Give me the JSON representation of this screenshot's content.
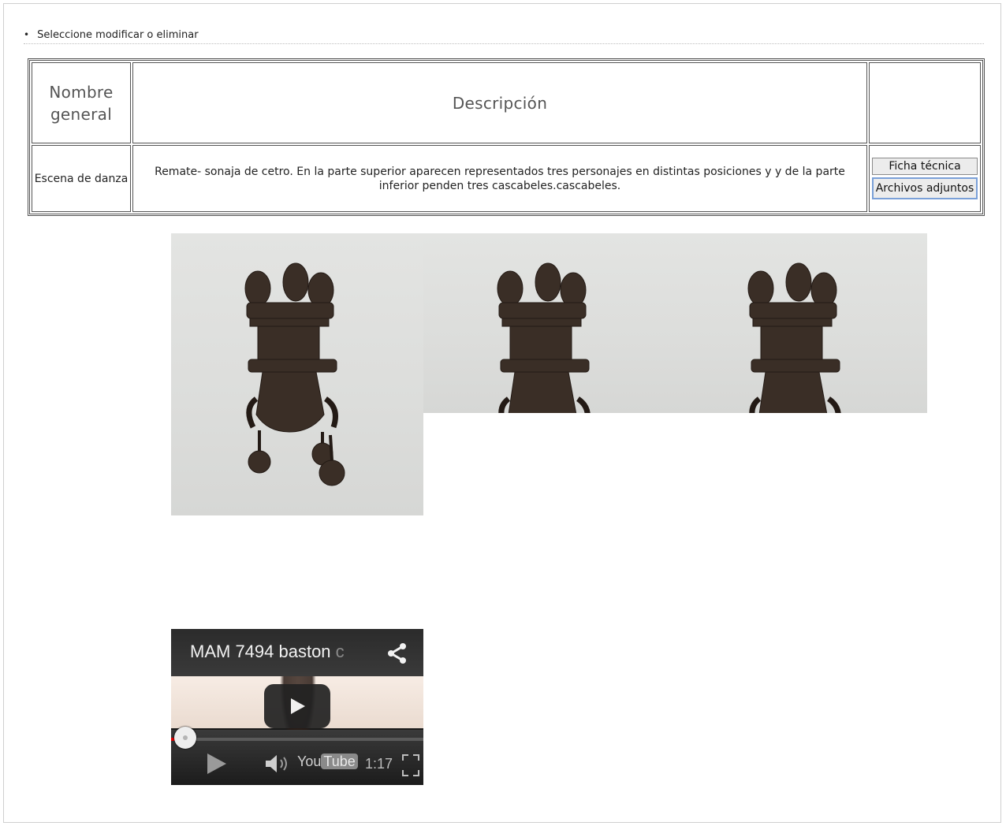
{
  "instruction": {
    "bullet": "•",
    "text": "Seleccione modificar o eliminar"
  },
  "table": {
    "headers": [
      "Nombre general",
      "Descripción",
      ""
    ],
    "rows": [
      {
        "name": "Escena de danza",
        "description": "Remate- sonaja de cetro. En la parte superior aparecen representados tres personajes en distintas posiciones y y de la parte inferior penden tres cascabeles.cascabeles.",
        "actions": [
          "Ficha técnica",
          "Archivos adjuntos"
        ]
      }
    ]
  },
  "video": {
    "title": "MAM 7494 baston",
    "title_fade": "c",
    "brand_you": "You",
    "brand_tube": "Tube",
    "duration": "1:17",
    "progress": 0.02
  },
  "colors": {
    "accent_focus": "#7aa0d8",
    "progress": "#dd0000"
  }
}
